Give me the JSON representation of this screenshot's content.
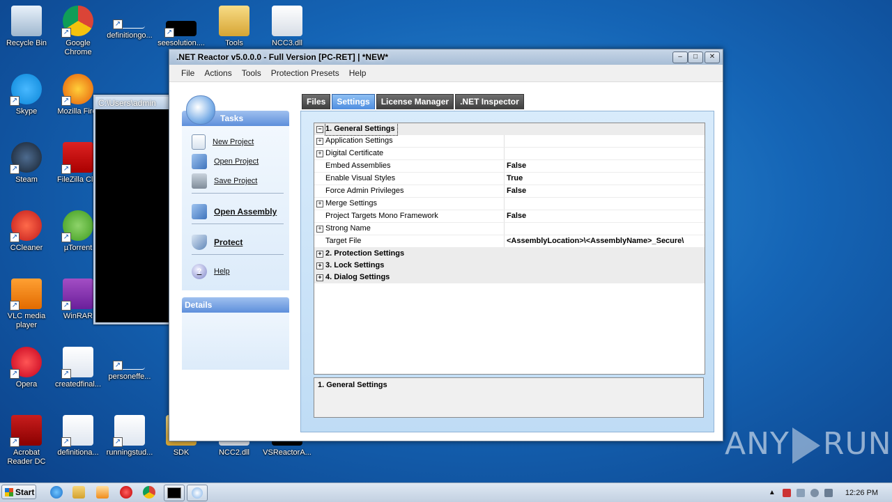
{
  "desktop": {
    "icons": [
      {
        "label": "Recycle Bin",
        "icon": "recycle-bin-icon"
      },
      {
        "label": "Google Chrome",
        "icon": "chrome-icon"
      },
      {
        "label": "definitiongo...",
        "icon": "file-icon"
      },
      {
        "label": "seesolution....",
        "icon": "file-icon"
      },
      {
        "label": "Tools",
        "icon": "folder-icon"
      },
      {
        "label": "NCC3.dll",
        "icon": "dll-icon"
      },
      {
        "label": "Skype",
        "icon": "skype-icon"
      },
      {
        "label": "Mozilla Firef",
        "icon": "firefox-icon"
      },
      {
        "label": "Steam",
        "icon": "steam-icon"
      },
      {
        "label": "FileZilla Clie",
        "icon": "filezilla-icon"
      },
      {
        "label": "CCleaner",
        "icon": "ccleaner-icon"
      },
      {
        "label": "µTorrent",
        "icon": "utorrent-icon"
      },
      {
        "label": "VLC media player",
        "icon": "vlc-icon"
      },
      {
        "label": "WinRAR",
        "icon": "winrar-icon"
      },
      {
        "label": "Opera",
        "icon": "opera-icon"
      },
      {
        "label": "createdfinal...",
        "icon": "word-doc-icon"
      },
      {
        "label": "personeffe...",
        "icon": "file-icon"
      },
      {
        "label": "Acrobat Reader DC",
        "icon": "acrobat-icon"
      },
      {
        "label": "definitiona...",
        "icon": "word-doc-icon"
      },
      {
        "label": "runningstud...",
        "icon": "word-doc-icon"
      },
      {
        "label": "SDK",
        "icon": "folder-icon"
      },
      {
        "label": "NCC2.dll",
        "icon": "dll-icon"
      },
      {
        "label": "VSReactorA...",
        "icon": "file-icon"
      }
    ]
  },
  "console": {
    "title": "C:\\Users\\admin"
  },
  "window": {
    "title": ".NET Reactor v5.0.0.0 - Full Version [PC-RET]  | *NEW*",
    "menu": [
      "File",
      "Actions",
      "Tools",
      "Protection Presets",
      "Help"
    ],
    "tasks": {
      "header": "Tasks",
      "items": [
        "New Project",
        "Open Project",
        "Save Project",
        "Open Assembly",
        "Protect",
        "Help"
      ]
    },
    "details_header": "Details",
    "tabs": [
      "Files",
      "Settings",
      "License Manager",
      ".NET Inspector"
    ],
    "active_tab": "Settings",
    "grid": {
      "rows": [
        {
          "type": "cat",
          "expander": "−",
          "name": "1. General Settings",
          "value": "",
          "selected": true
        },
        {
          "type": "sub",
          "expander": "+",
          "name": "Application Settings",
          "value": ""
        },
        {
          "type": "sub",
          "expander": "+",
          "name": "Digital Certificate",
          "value": ""
        },
        {
          "type": "sub",
          "expander": "",
          "name": "Embed Assemblies",
          "value": "False"
        },
        {
          "type": "sub",
          "expander": "",
          "name": "Enable Visual Styles",
          "value": "True"
        },
        {
          "type": "sub",
          "expander": "",
          "name": "Force Admin Privileges",
          "value": "False"
        },
        {
          "type": "sub",
          "expander": "+",
          "name": "Merge Settings",
          "value": ""
        },
        {
          "type": "sub",
          "expander": "",
          "name": "Project Targets Mono Framework",
          "value": "False"
        },
        {
          "type": "sub",
          "expander": "+",
          "name": "Strong Name",
          "value": ""
        },
        {
          "type": "sub",
          "expander": "",
          "name": "Target File",
          "value": "<AssemblyLocation>\\<AssemblyName>_Secure\\"
        },
        {
          "type": "cat",
          "expander": "+",
          "name": "2. Protection Settings",
          "value": ""
        },
        {
          "type": "cat",
          "expander": "+",
          "name": "3. Lock Settings",
          "value": ""
        },
        {
          "type": "cat",
          "expander": "+",
          "name": "4. Dialog Settings",
          "value": ""
        }
      ]
    },
    "description": "1. General Settings"
  },
  "watermark": {
    "left": "ANY",
    "right": "RUN"
  },
  "taskbar": {
    "start_label": "Start",
    "clock": "12:26 PM"
  }
}
